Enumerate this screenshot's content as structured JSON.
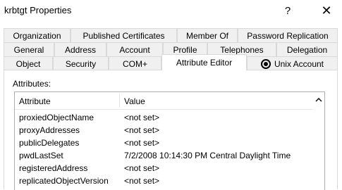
{
  "window": {
    "title": "krbtgt Properties",
    "help_label": "?",
    "close_label": "✕"
  },
  "tabs": {
    "row1": [
      "Organization",
      "Published Certificates",
      "Member Of",
      "Password Replication"
    ],
    "row2": [
      "General",
      "Address",
      "Account",
      "Profile",
      "Telephones",
      "Delegation"
    ],
    "row3": [
      "Object",
      "Security",
      "COM+",
      "Attribute Editor",
      "Unix Account"
    ],
    "active": "Attribute Editor"
  },
  "attributes_section": {
    "label": "Attributes:",
    "columns": [
      "Attribute",
      "Value"
    ],
    "rows": [
      {
        "attribute": "proxiedObjectName",
        "value": "<not set>"
      },
      {
        "attribute": "proxyAddresses",
        "value": "<not set>"
      },
      {
        "attribute": "publicDelegates",
        "value": "<not set>"
      },
      {
        "attribute": "pwdLastSet",
        "value": "7/2/2008 10:14:30 PM Central Daylight Time"
      },
      {
        "attribute": "registeredAddress",
        "value": "<not set>"
      },
      {
        "attribute": "replicatedObjectVersion",
        "value": "<not set>"
      }
    ]
  },
  "colors": {
    "tab_inactive": "#f0f0f0",
    "tab_active": "#ffffff",
    "border": "#d9d9d9"
  },
  "icons": {
    "unix_tab": "unix-account-icon",
    "scroll_up": "chevron-up-icon"
  }
}
